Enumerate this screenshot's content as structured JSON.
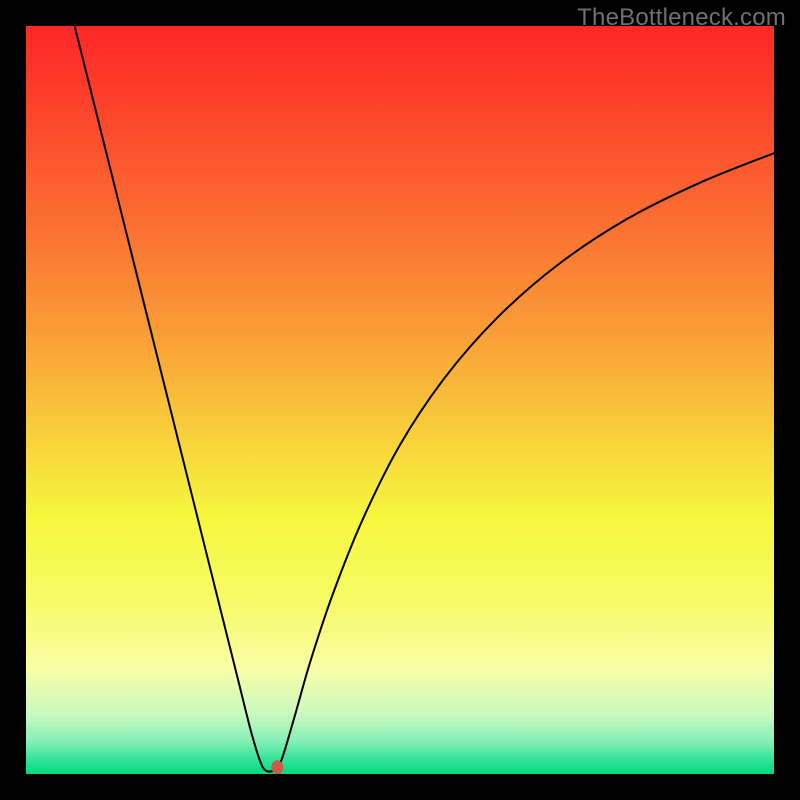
{
  "watermark": "TheBottleneck.com",
  "chart_data": {
    "type": "line",
    "title": "",
    "xlabel": "",
    "ylabel": "",
    "xlim": [
      0,
      100
    ],
    "ylim": [
      0,
      100
    ],
    "background_gradient": {
      "stops": [
        {
          "offset": 0.0,
          "color": "#fd2727"
        },
        {
          "offset": 0.08,
          "color": "#fd3b2a"
        },
        {
          "offset": 0.18,
          "color": "#fc572e"
        },
        {
          "offset": 0.3,
          "color": "#fb7a33"
        },
        {
          "offset": 0.42,
          "color": "#faa137"
        },
        {
          "offset": 0.55,
          "color": "#f8d13b"
        },
        {
          "offset": 0.66,
          "color": "#f6f83e"
        },
        {
          "offset": 0.76,
          "color": "#f7fb62"
        },
        {
          "offset": 0.86,
          "color": "#f9fea6"
        },
        {
          "offset": 0.92,
          "color": "#c9fac0"
        },
        {
          "offset": 0.955,
          "color": "#88f0b8"
        },
        {
          "offset": 0.978,
          "color": "#3be59b"
        },
        {
          "offset": 1.0,
          "color": "#00da80"
        }
      ]
    },
    "series": [
      {
        "name": "bottleneck-curve",
        "stroke": "#000000",
        "stroke_width": 2,
        "points": [
          {
            "x": 6.5,
            "y": 100.0
          },
          {
            "x": 9.0,
            "y": 90.0
          },
          {
            "x": 12.0,
            "y": 78.0
          },
          {
            "x": 15.0,
            "y": 66.0
          },
          {
            "x": 18.0,
            "y": 54.0
          },
          {
            "x": 21.0,
            "y": 42.0
          },
          {
            "x": 24.0,
            "y": 30.0
          },
          {
            "x": 26.5,
            "y": 20.0
          },
          {
            "x": 28.5,
            "y": 12.0
          },
          {
            "x": 30.0,
            "y": 6.0
          },
          {
            "x": 31.2,
            "y": 2.0
          },
          {
            "x": 32.0,
            "y": 0.5
          },
          {
            "x": 33.2,
            "y": 0.5
          },
          {
            "x": 34.2,
            "y": 2.0
          },
          {
            "x": 36.0,
            "y": 8.0
          },
          {
            "x": 38.0,
            "y": 15.0
          },
          {
            "x": 41.0,
            "y": 24.0
          },
          {
            "x": 45.0,
            "y": 34.0
          },
          {
            "x": 50.0,
            "y": 44.0
          },
          {
            "x": 56.0,
            "y": 53.0
          },
          {
            "x": 63.0,
            "y": 61.0
          },
          {
            "x": 71.0,
            "y": 68.0
          },
          {
            "x": 80.0,
            "y": 74.0
          },
          {
            "x": 90.0,
            "y": 79.0
          },
          {
            "x": 100.0,
            "y": 83.0
          }
        ]
      }
    ],
    "marker": {
      "x": 33.6,
      "y": 0.9,
      "color": "#cc5a4a",
      "rx": 6,
      "ry": 7
    }
  }
}
